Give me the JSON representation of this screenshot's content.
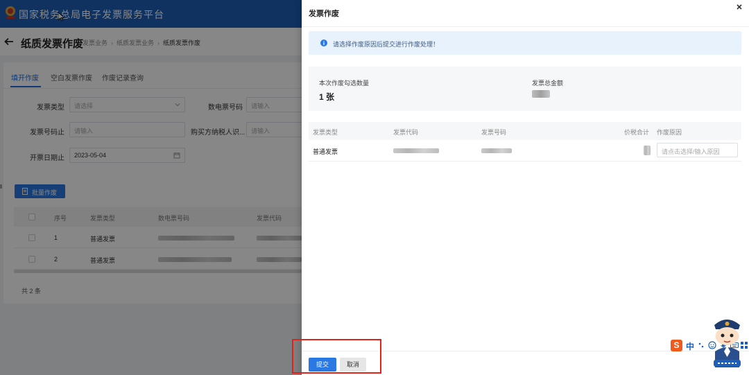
{
  "header": {
    "app_title": "国家税务总局电子发票服务平台"
  },
  "titlebar": {
    "page_title": "纸质发票作废",
    "breadcrumb": [
      "发票业务",
      "纸质发票业务",
      "纸质发票作废"
    ]
  },
  "tabs": [
    "填开作废",
    "空白发票作废",
    "作废记录查询"
  ],
  "form": {
    "invoice_type": {
      "label": "发票类型",
      "placeholder": "请选择"
    },
    "digital_no": {
      "label": "数电票号码",
      "placeholder": "请输入"
    },
    "invoice_no_end": {
      "label": "发票号码止",
      "placeholder": "请输入"
    },
    "buyer_tax_id": {
      "label": "购买方纳税人识...",
      "placeholder": "请输入"
    },
    "issue_date_end": {
      "label": "开票日期止",
      "value": "2023-05-04"
    }
  },
  "batch_button": "批量作废",
  "table": {
    "headers": [
      "序号",
      "发票类型",
      "数电票号码",
      "发票代码"
    ],
    "rows": [
      {
        "index": "1",
        "type": "普通发票"
      },
      {
        "index": "2",
        "type": "普通发票"
      }
    ],
    "total": "共 2 条"
  },
  "drawer": {
    "title": "发票作废",
    "alert": "请选择作废原因后提交进行作废处理！",
    "summary": {
      "count_label": "本次作废勾选数量",
      "count_value": "1 张",
      "amount_label": "发票总金额"
    },
    "table_headers": [
      "发票类型",
      "发票代码",
      "发票号码",
      "价税合计",
      "作废原因"
    ],
    "row": {
      "type": "普通发票",
      "reason_placeholder": "请点击选择/输入原因"
    },
    "submit": "提交",
    "cancel": "取消"
  },
  "ime": {
    "label": "中"
  },
  "colors": {
    "brand": "#1d5fb8",
    "primary": "#2a78e3",
    "highlight": "#e0211c",
    "alert_bg": "#e8f2fd"
  }
}
